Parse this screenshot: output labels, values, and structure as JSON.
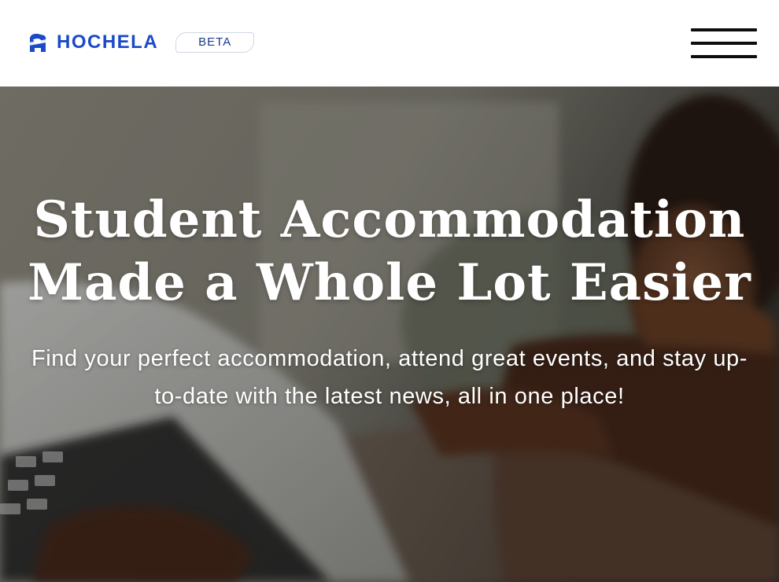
{
  "header": {
    "brand_name": "HOCHELA",
    "badge": "BETA",
    "logo_icon": "hochela-logo-icon",
    "menu_icon": "hamburger-menu-icon",
    "brand_color": "#1a49c9"
  },
  "hero": {
    "title": "Student Accommodation Made a Whole Lot Easier",
    "subtitle": "Find your perfect accommodation, attend great events, and stay up-to-date with the latest news, all in one place!",
    "background_image": "student-working-on-laptop-photo"
  }
}
